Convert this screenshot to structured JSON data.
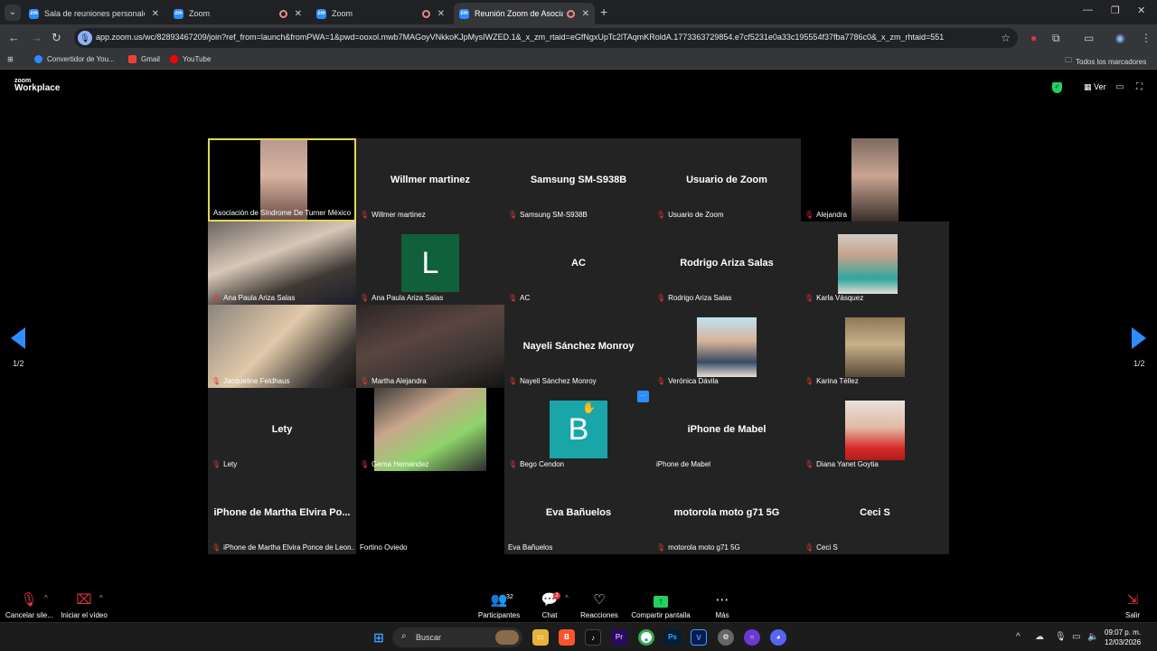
{
  "browser": {
    "tabs": [
      {
        "label": "Sala de reuniones personales d",
        "active": false,
        "recording": false
      },
      {
        "label": "Zoom",
        "active": false,
        "recording": true
      },
      {
        "label": "Zoom",
        "active": false,
        "recording": true
      },
      {
        "label": "Reunión Zoom de Asociació",
        "active": true,
        "recording": true
      }
    ],
    "url": "app.zoom.us/wc/82893467209/join?ref_from=launch&fromPWA=1&pwd=ooxol.mwb7MAGoyVNkkoKJpMysIWZED.1&_x_zm_rtaid=eGfNgxUpTc2lTAqmKRoldA.1773363729854.e7cf5231e0a33c195554f37fba7786c0&_x_zm_rhtaid=551",
    "bookmarks": [
      "Convertidor de You...",
      "Gmail",
      "YouTube"
    ],
    "all_bookmarks": "Todos los marcadores"
  },
  "zoom": {
    "logo_top": "zoom",
    "logo_bottom": "Workplace",
    "view_label": "Ver",
    "page_indicator": "1/2",
    "tiles": [
      {
        "name": "Asociación de Síndrome De Turner México",
        "big": "",
        "muted": false,
        "kind": "video",
        "speaking": true
      },
      {
        "name": "Willmer martinez",
        "big": "Willmer martinez",
        "muted": true,
        "kind": "name"
      },
      {
        "name": "Samsung SM-S938B",
        "big": "Samsung SM-S938B",
        "muted": true,
        "kind": "name"
      },
      {
        "name": "Usuario de Zoom",
        "big": "Usuario de Zoom",
        "muted": true,
        "kind": "name"
      },
      {
        "name": "Alejandra",
        "big": "",
        "muted": true,
        "kind": "video"
      },
      {
        "name": "Ana Paula Ariza Salas",
        "big": "",
        "muted": true,
        "kind": "video"
      },
      {
        "name": "Ana Paula Ariza Salas",
        "big": "",
        "muted": true,
        "kind": "letter",
        "letter": "L"
      },
      {
        "name": "AC",
        "big": "AC",
        "muted": true,
        "kind": "name"
      },
      {
        "name": "Rodrigo Ariza Salas",
        "big": "Rodrigo Ariza Salas",
        "muted": true,
        "kind": "name"
      },
      {
        "name": "Karla Vásquez",
        "big": "",
        "muted": true,
        "kind": "photo"
      },
      {
        "name": "Jacqueline Feldhaus",
        "big": "",
        "muted": true,
        "kind": "video"
      },
      {
        "name": "Martha Alejandra",
        "big": "",
        "muted": true,
        "kind": "video"
      },
      {
        "name": "Nayeli Sánchez Monroy",
        "big": "Nayeli Sánchez Monroy",
        "muted": true,
        "kind": "name"
      },
      {
        "name": "Verónica Dávila",
        "big": "",
        "muted": true,
        "kind": "photo"
      },
      {
        "name": "Karina Téllez",
        "big": "",
        "muted": true,
        "kind": "photo"
      },
      {
        "name": "Lety",
        "big": "Lety",
        "muted": true,
        "kind": "name"
      },
      {
        "name": "Gema Hernandez",
        "big": "",
        "muted": true,
        "kind": "video"
      },
      {
        "name": "Bego Cendon",
        "big": "",
        "muted": true,
        "kind": "letter",
        "letter": "B"
      },
      {
        "name": "iPhone de Mabel",
        "big": "iPhone de Mabel",
        "muted": false,
        "kind": "name"
      },
      {
        "name": "Diana Yanet Goytia",
        "big": "",
        "muted": true,
        "kind": "photo"
      },
      {
        "name": "iPhone de Martha Elvira Ponce de Leon...",
        "big": "iPhone de Martha Elvira Po...",
        "muted": true,
        "kind": "name"
      },
      {
        "name": "Fortino Oviedo",
        "big": "",
        "muted": false,
        "kind": "blank"
      },
      {
        "name": "Eva Bañuelos",
        "big": "Eva Bañuelos",
        "muted": false,
        "kind": "name"
      },
      {
        "name": "motorola moto g71 5G",
        "big": "motorola moto g71 5G",
        "muted": true,
        "kind": "name"
      },
      {
        "name": "Ceci S",
        "big": "Ceci S",
        "muted": true,
        "kind": "name"
      }
    ],
    "toolbar": {
      "mic": "Cancelar sile...",
      "video": "Iniciar el vídeo",
      "participants": "Participantes",
      "participants_count": "32",
      "chat": "Chat",
      "chat_badge": "2",
      "reactions": "Reacciones",
      "share": "Compartir pantalla",
      "more": "Más",
      "leave": "Salir"
    },
    "colors": {
      "accent": "#2d8cff",
      "share": "#23d160",
      "mute": "#e0363b",
      "speaker": "#e2d75a"
    }
  },
  "taskbar": {
    "search": "Buscar",
    "time": "09:07 p. m.",
    "date": "12/03/2026"
  }
}
